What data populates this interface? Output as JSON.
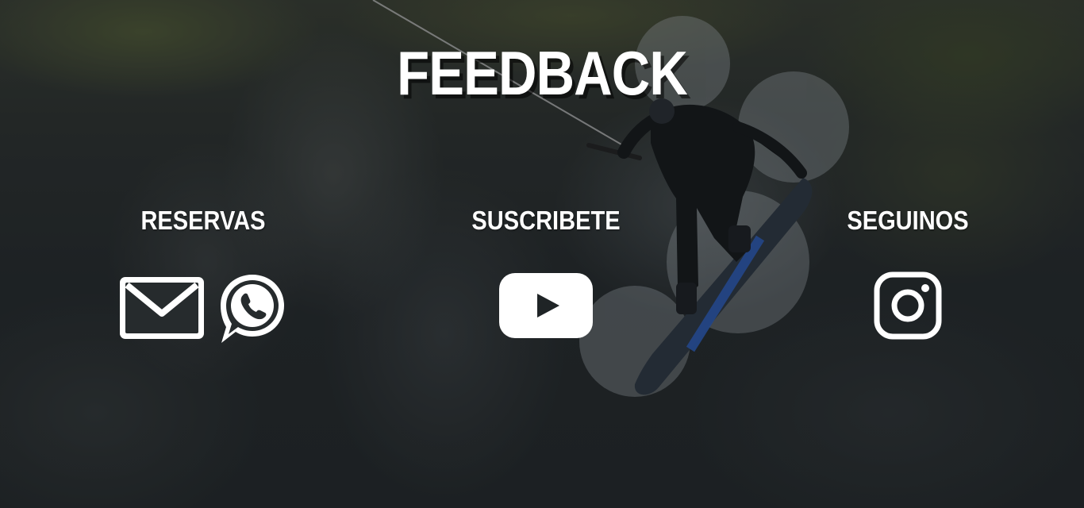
{
  "page": {
    "title": "FEEDBACK"
  },
  "sections": [
    {
      "heading": "RESERVAS",
      "icons": [
        "envelope-icon",
        "whatsapp-icon"
      ]
    },
    {
      "heading": "SUSCRIBETE",
      "icons": [
        "youtube-icon"
      ]
    },
    {
      "heading": "SEGUINOS",
      "icons": [
        "instagram-icon"
      ]
    }
  ],
  "colors": {
    "text": "#ffffff",
    "youtube_play": "#1f2426"
  }
}
